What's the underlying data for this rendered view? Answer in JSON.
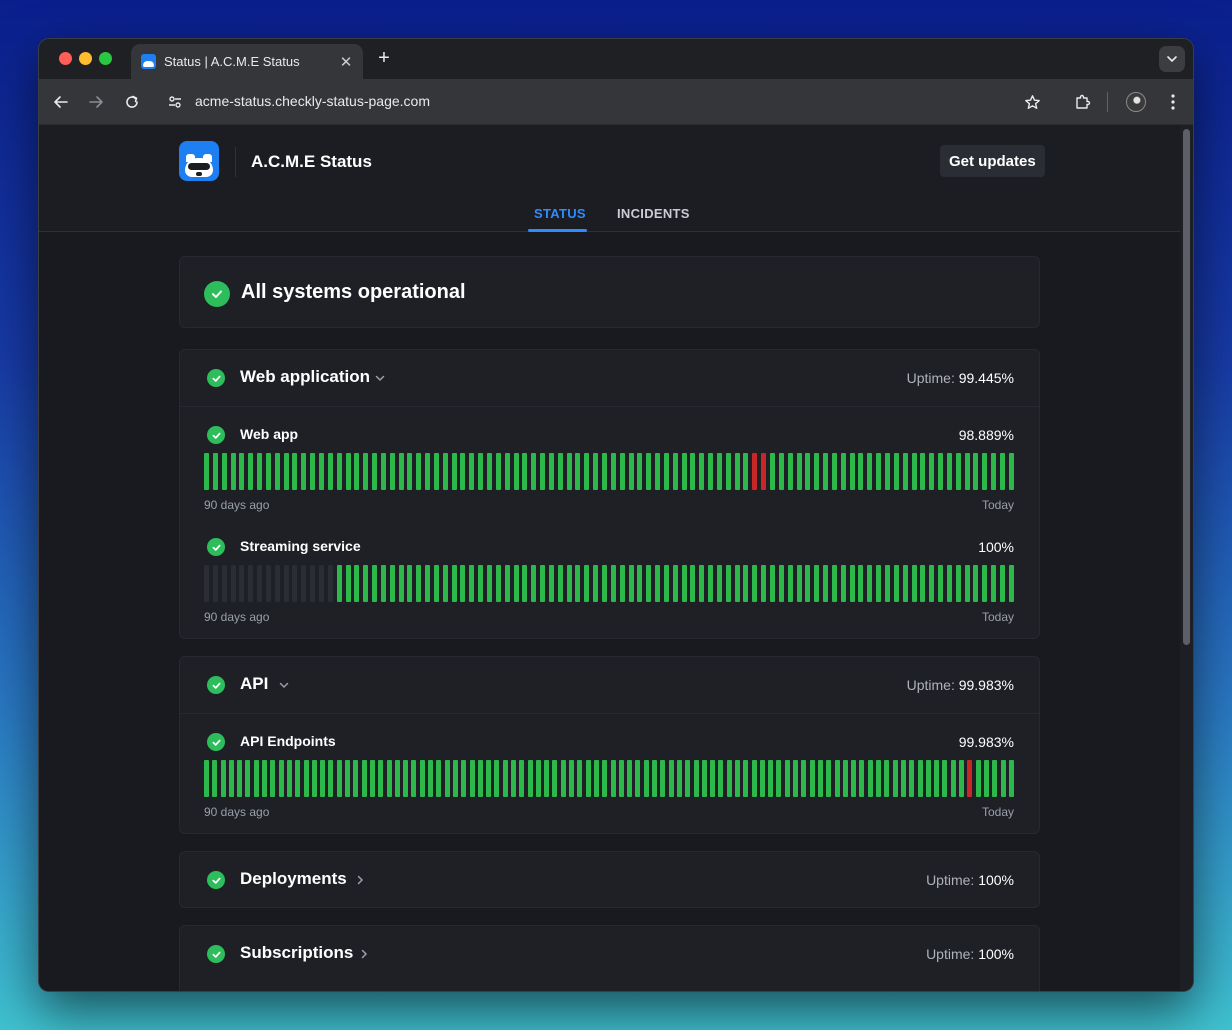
{
  "browser": {
    "tab_title": "Status | A.C.M.E Status",
    "tab_close": "✕",
    "new_tab": "+",
    "url": "acme-status.checkly-status-page.com"
  },
  "header": {
    "brand": "A.C.M.E Status",
    "get_updates": "Get updates",
    "tabs": [
      {
        "label": "STATUS",
        "active": true
      },
      {
        "label": "INCIDENTS",
        "active": false
      }
    ]
  },
  "overall": {
    "title": "All systems operational"
  },
  "uptime_label": "Uptime:",
  "groups": [
    {
      "title": "Web application",
      "uptime": "99.445%",
      "expanded": true,
      "components": [
        {
          "name": "Web app",
          "uptime": "98.889%",
          "from": "90 days ago",
          "to": "Today",
          "days": "ggggggggggggggggggggggggggggggggggggggggggggggggggggggggggggggrrgggggggggggggggggggggggggggg"
        },
        {
          "name": "Streaming service",
          "uptime": "100%",
          "from": "90 days ago",
          "to": "Today",
          "days": "nnnnnnnnnnnnnnnggggggggggggggggggggggggggggggggggggggggggggggggggggggggggggggggggggggggggggg"
        }
      ]
    },
    {
      "title": "API",
      "uptime": "99.983%",
      "expanded": true,
      "components": [
        {
          "name": "API Endpoints",
          "uptime": "99.983%",
          "from": "90 days ago",
          "to": "Today",
          "days": "ggggggggggggggggggggggggggggggggggggggggggggggggggggggggggggggggggggggggggggggggggggggggggggrggggg"
        }
      ]
    },
    {
      "title": "Deployments",
      "uptime": "100%",
      "expanded": false
    },
    {
      "title": "Subscriptions",
      "uptime": "100%",
      "expanded": false
    }
  ],
  "colors": {
    "operational": "#2db84b",
    "outage": "#c62828",
    "no_data": "#2a2d34",
    "accent": "#2f8cff"
  }
}
